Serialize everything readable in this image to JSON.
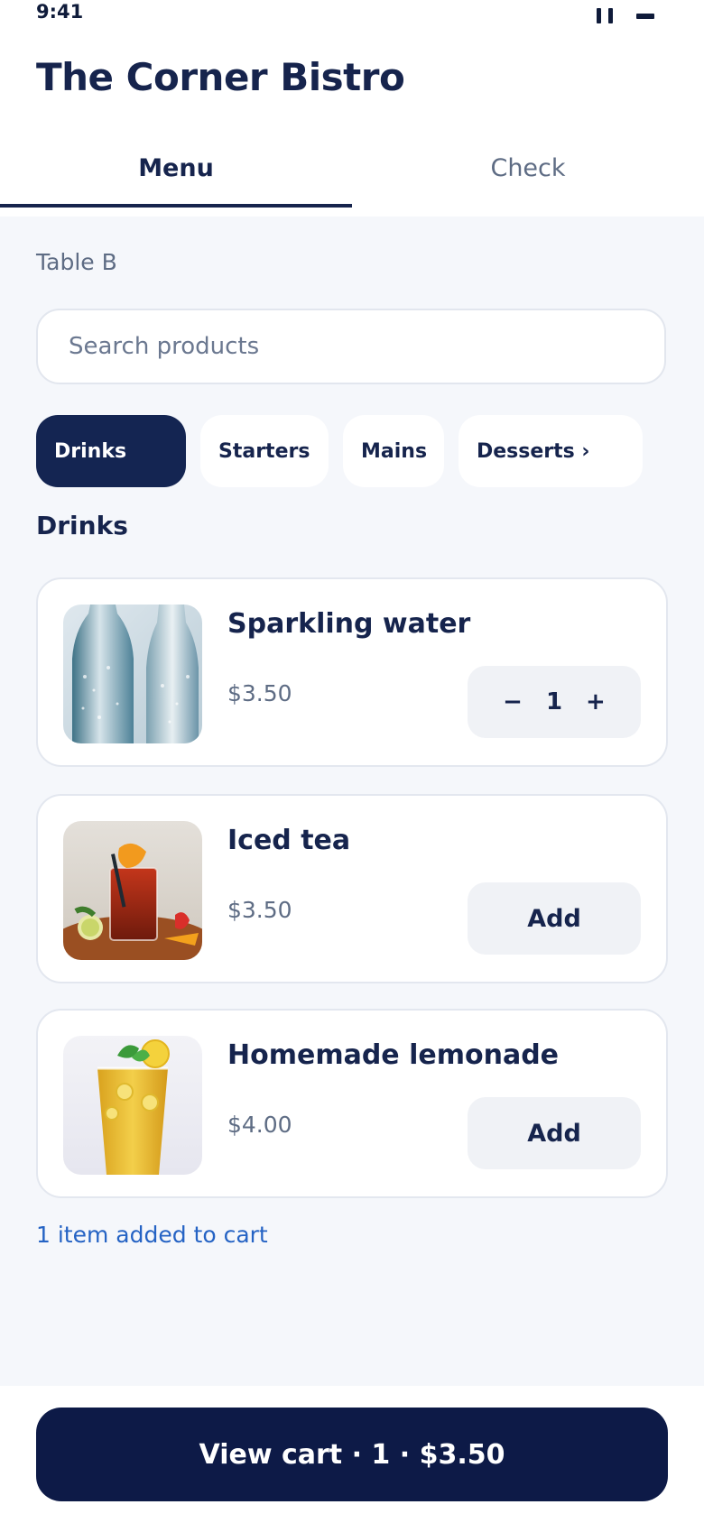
{
  "status_bar": {
    "time": "9:41"
  },
  "header": {
    "title": "The Corner Bistro"
  },
  "tabs": [
    {
      "label": "Menu",
      "active": true
    },
    {
      "label": "Check",
      "active": false
    }
  ],
  "table": {
    "label": "Table B"
  },
  "search": {
    "placeholder": "Search products",
    "value": ""
  },
  "categories": [
    {
      "label": "Drinks",
      "active": true
    },
    {
      "label": "Starters",
      "active": false
    },
    {
      "label": "Mains",
      "active": false
    },
    {
      "label": "Desserts ›",
      "active": false
    }
  ],
  "section": {
    "title": "Drinks"
  },
  "products": [
    {
      "name": "Sparkling water",
      "price": "$3.50",
      "quantity": "1",
      "in_cart": true,
      "image": "sparkling-water-bottles"
    },
    {
      "name": "Iced tea",
      "price": "$3.50",
      "action_label": "Add",
      "in_cart": false,
      "image": "iced-tea-glass"
    },
    {
      "name": "Homemade lemonade",
      "price": "$4.00",
      "action_label": "Add",
      "in_cart": false,
      "image": "lemonade-glass"
    }
  ],
  "stepper": {
    "minus": "−",
    "plus": "+"
  },
  "cart_note": "1 item added to cart",
  "footer": {
    "view_cart_label": "View cart · 1 · $3.50"
  },
  "colors": {
    "primary": "#142552",
    "cart_button": "#0d1a47",
    "background": "#f5f7fb",
    "link": "#2563c4"
  }
}
